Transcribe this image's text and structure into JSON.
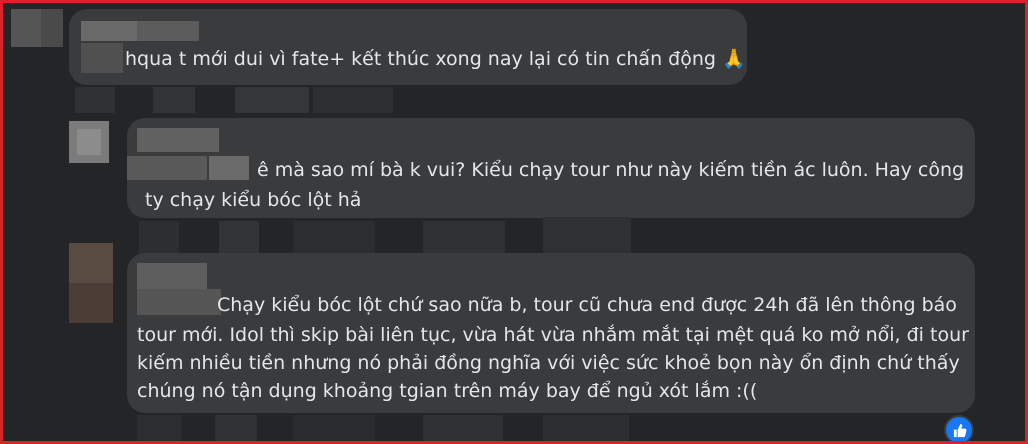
{
  "comments": [
    {
      "text": "hqua t mới dui vì fate+ kết thúc xong nay lại có tin chấn động",
      "emoji": "🙏"
    },
    {
      "line1": "ê mà sao mí bà k vui? Kiểu chạy tour như này kiếm tiền ác luôn. Hay công",
      "line2": "ty chạy kiểu bóc lột hả"
    },
    {
      "line1": "Chạy kiểu bóc lột chứ sao nữa b, tour cũ chưa end được 24h đã lên thông báo",
      "line2": "tour mới. Idol thì skip bài liên tục, vừa hát vừa nhắm mắt tại mệt quá ko mở nổi, đi tour",
      "line3": "kiếm nhiều tiền nhưng nó phải đồng nghĩa với việc sức khoẻ bọn này ổn định chứ thấy",
      "line4": "chúng nó tận dụng khoảng tgian trên máy bay để ngủ xót lắm :(("
    }
  ],
  "reaction": {
    "icon": "like-icon",
    "color": "#1877f2"
  },
  "colors": {
    "background": "#242526",
    "bubble": "#3a3b3c",
    "text": "#e4e6eb",
    "border": "#d8232a"
  }
}
